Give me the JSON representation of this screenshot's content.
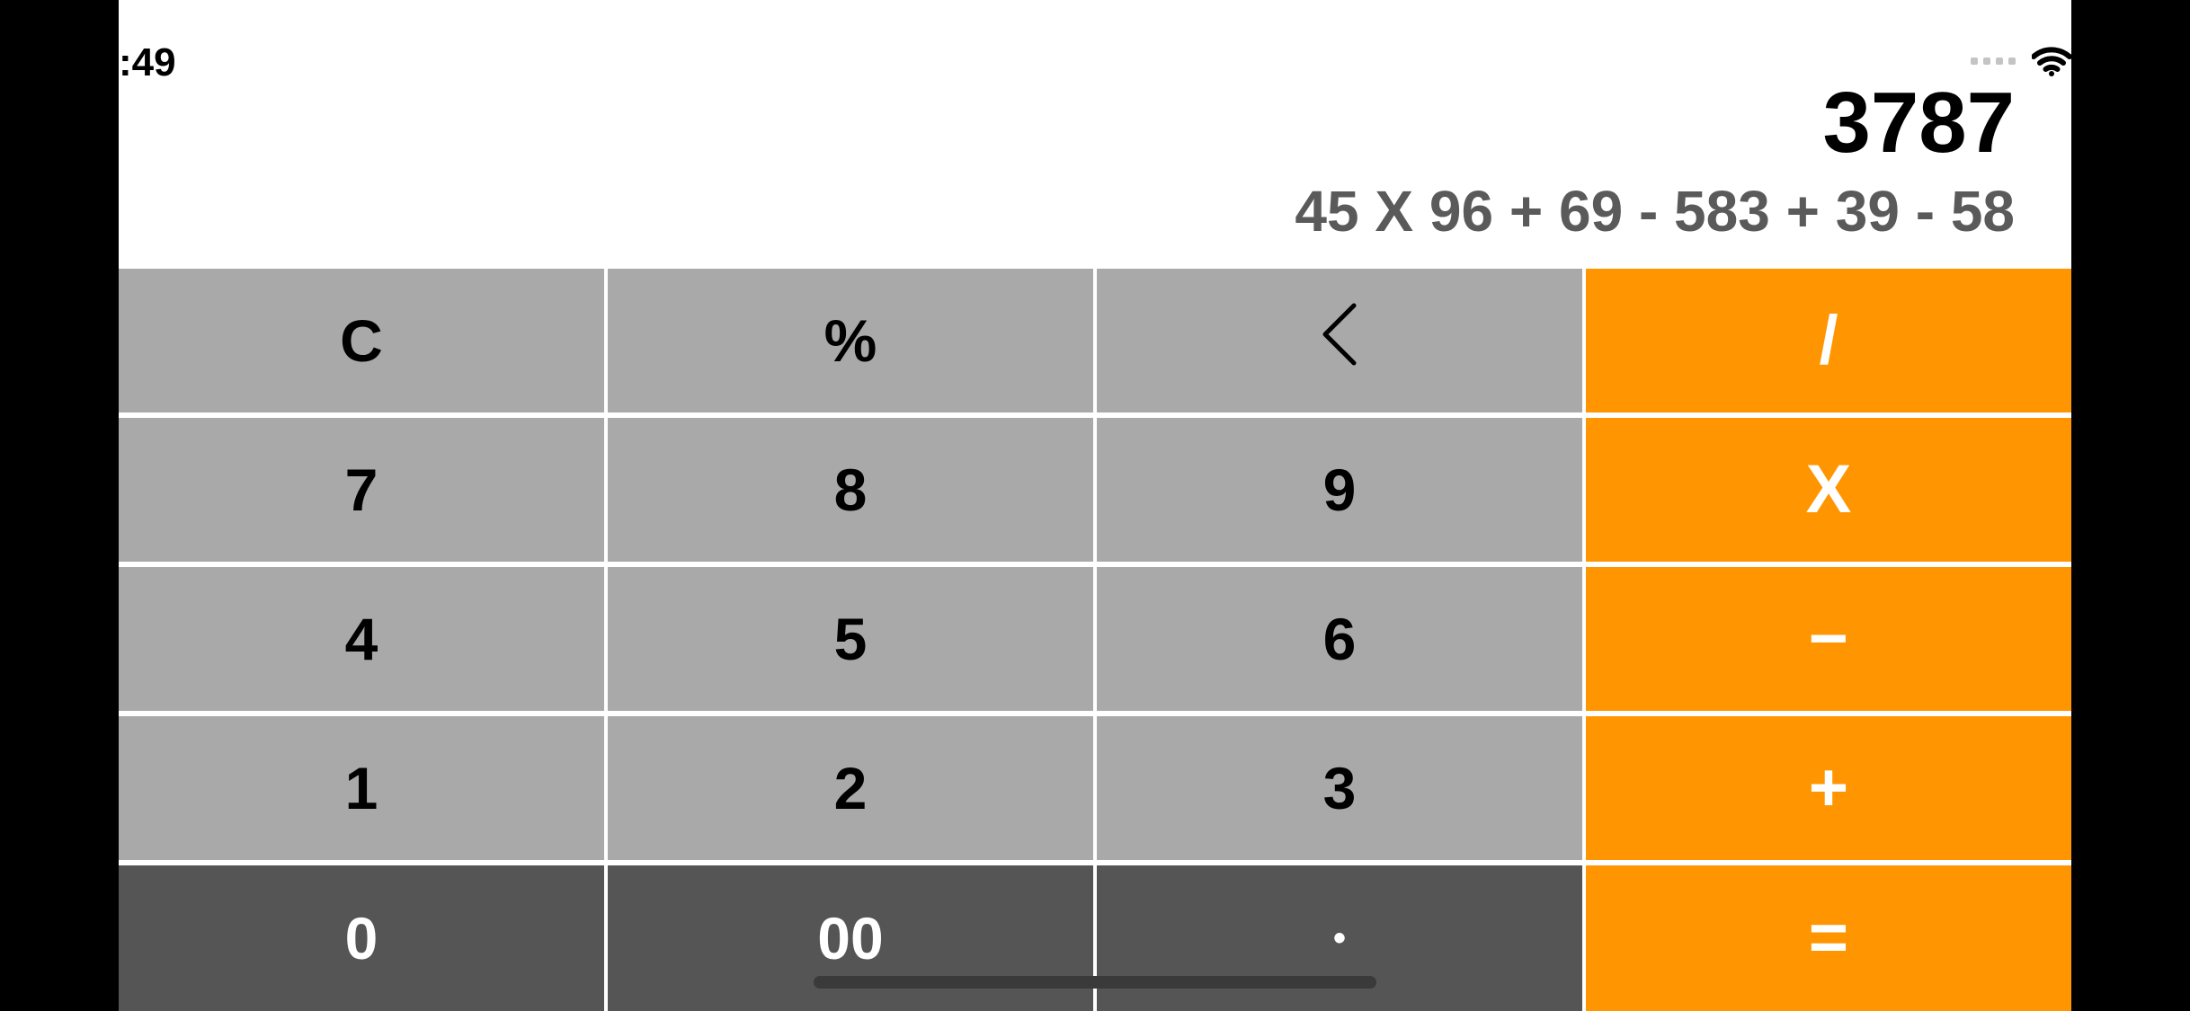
{
  "status_bar": {
    "time": ":49",
    "signal_icon": "cellular-signal-icon",
    "wifi_icon": "wifi-icon"
  },
  "display": {
    "result": "3787",
    "expression": "45 X 96 + 69 - 583 + 39 - 58"
  },
  "keys": {
    "clear": "C",
    "percent": "%",
    "backspace_icon": "chevron-left-icon",
    "divide": "/",
    "seven": "7",
    "eight": "8",
    "nine": "9",
    "multiply": "X",
    "four": "4",
    "five": "5",
    "six": "6",
    "minus": "−",
    "one": "1",
    "two": "2",
    "three": "3",
    "plus": "+",
    "zero": "0",
    "double_zero": "00",
    "decimal": "•",
    "equals": "="
  },
  "colors": {
    "function_key": "#a9a9a9",
    "operator_key": "#ff9500",
    "bottom_row_key": "#555555",
    "expression_text": "#5a5a5a"
  }
}
